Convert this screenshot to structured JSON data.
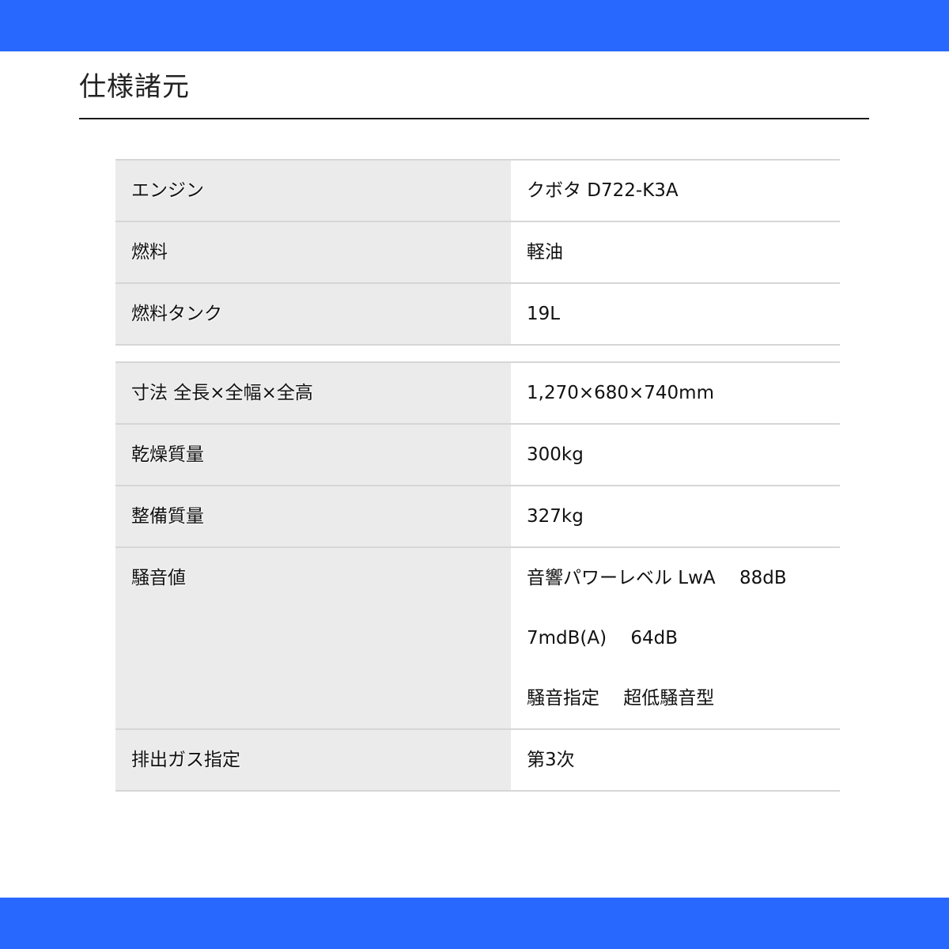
{
  "page": {
    "title": "仕様諸元"
  },
  "colors": {
    "accent_bar": "#2968ff",
    "label_bg": "#ebebeb",
    "row_border": "#d6d6d6"
  },
  "specs_group_1": [
    {
      "label": "エンジン",
      "value": "クボタ D722-K3A"
    },
    {
      "label": "燃料",
      "value": "軽油"
    },
    {
      "label": "燃料タンク",
      "value": "19L"
    }
  ],
  "specs_group_2": [
    {
      "label": "寸法 全長×全幅×全高",
      "value": "1,270×680×740mm"
    },
    {
      "label": "乾燥質量",
      "value": "300kg"
    },
    {
      "label": "整備質量",
      "value": "327kg"
    },
    {
      "label": "騒音値",
      "lines": [
        "音響パワーレベル LwA　 88dB",
        "7mdB(A)　 64dB",
        "騒音指定　 超低騒音型"
      ]
    },
    {
      "label": "排出ガス指定",
      "value": "第3次"
    }
  ]
}
